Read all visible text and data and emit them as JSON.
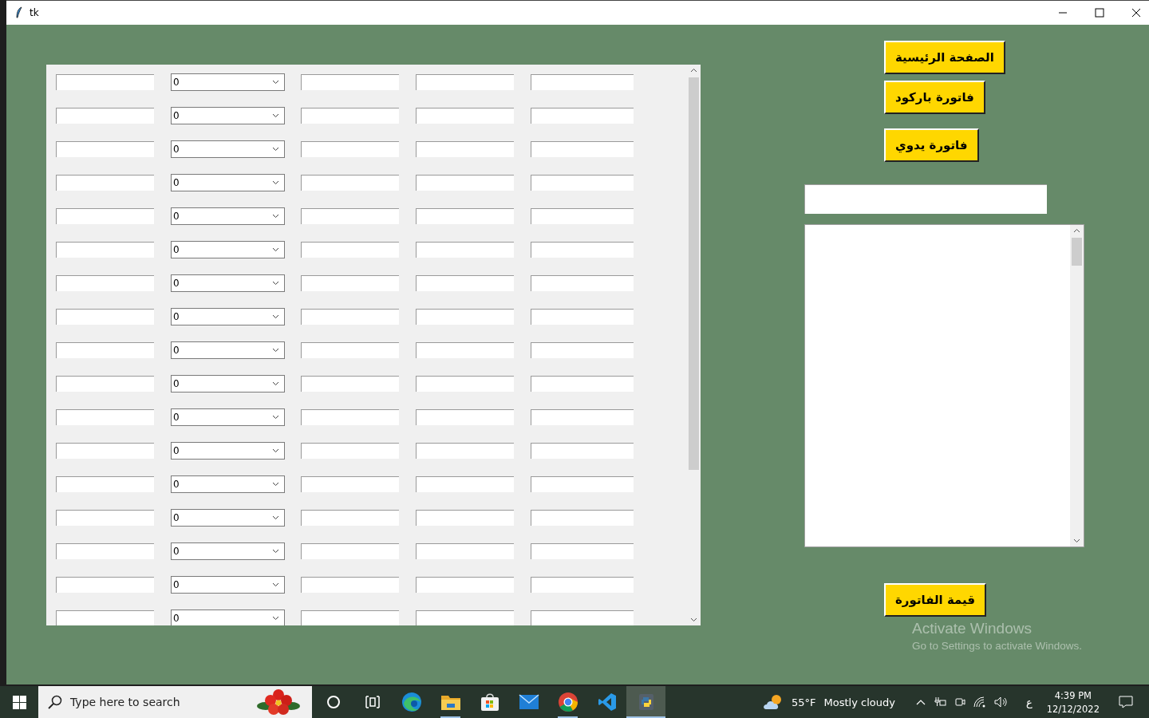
{
  "window": {
    "title": "tk"
  },
  "grid": {
    "rows": [
      {
        "combo": "0"
      },
      {
        "combo": "0"
      },
      {
        "combo": "0"
      },
      {
        "combo": "0"
      },
      {
        "combo": "0"
      },
      {
        "combo": "0"
      },
      {
        "combo": "0"
      },
      {
        "combo": "0"
      },
      {
        "combo": "0"
      },
      {
        "combo": "0"
      },
      {
        "combo": "0"
      },
      {
        "combo": "0"
      },
      {
        "combo": "0"
      },
      {
        "combo": "0"
      },
      {
        "combo": "0"
      },
      {
        "combo": "0"
      },
      {
        "combo": "0"
      }
    ]
  },
  "nav_buttons": [
    {
      "label": "الصفحة الرئيسية"
    },
    {
      "label": "فاتورة باركود"
    },
    {
      "label": "فاتورة يدوي"
    }
  ],
  "total_button": {
    "label": "قيمة الفاتورة"
  },
  "activation_notice": {
    "title": "Activate Windows",
    "subtitle": "Go to Settings to activate Windows."
  },
  "taskbar": {
    "search": {
      "placeholder": "Type here to search"
    },
    "apps": [
      {
        "kind": "cortana",
        "running": false,
        "selected": false
      },
      {
        "kind": "taskview",
        "running": false,
        "selected": false
      },
      {
        "kind": "edge",
        "running": false,
        "selected": false
      },
      {
        "kind": "folder",
        "running": true,
        "selected": false
      },
      {
        "kind": "store",
        "running": false,
        "selected": false
      },
      {
        "kind": "mail",
        "running": false,
        "selected": false
      },
      {
        "kind": "chrome",
        "running": true,
        "selected": false
      },
      {
        "kind": "code",
        "running": false,
        "selected": false
      },
      {
        "kind": "python",
        "running": true,
        "selected": true
      }
    ],
    "weather": {
      "temperature": "55°F",
      "condition": "Mostly cloudy"
    },
    "language": "ع",
    "time": "4:39 PM",
    "date": "12/12/2022"
  }
}
